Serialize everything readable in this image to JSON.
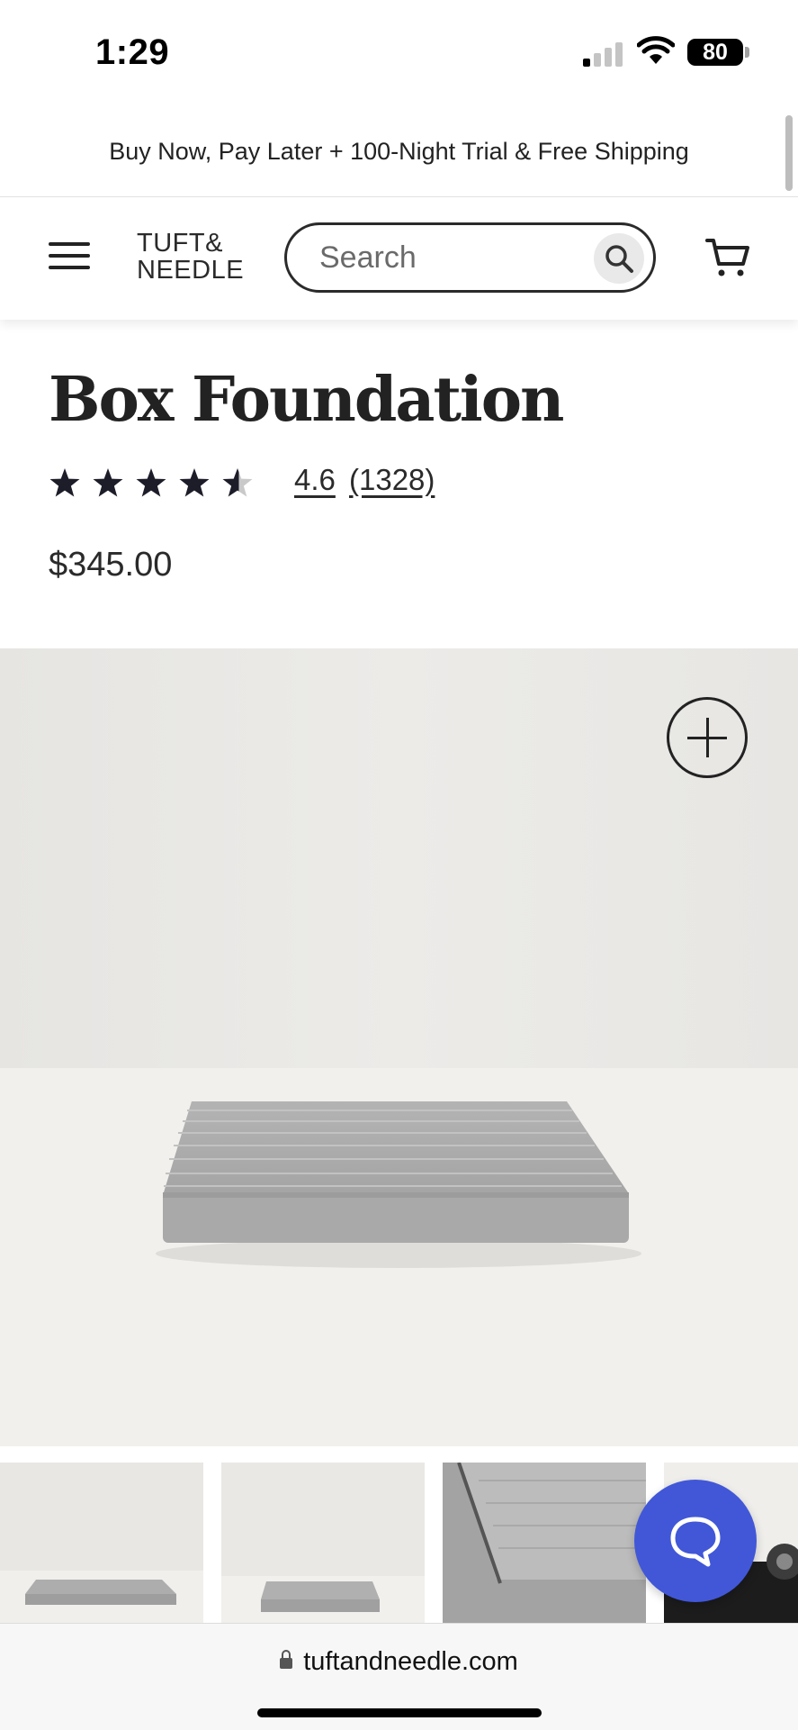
{
  "status_bar": {
    "time": "1:29",
    "battery": "80"
  },
  "promo": {
    "text": "Buy Now, Pay Later + 100-Night Trial & Free Shipping"
  },
  "header": {
    "logo_line1": "TUFT&",
    "logo_line2": "NEEDLE",
    "search_placeholder": "Search"
  },
  "product": {
    "title": "Box Foundation",
    "rating": 4.6,
    "rating_text": "4.6",
    "review_count": "(1328)",
    "price": "$345.00"
  },
  "gallery": {
    "thumbnail_count": 4
  },
  "browser": {
    "url": "tuftandneedle.com"
  },
  "colors": {
    "chat_button": "#4157d8",
    "text_dark": "#222222",
    "hero_bg": "#ebeae7"
  }
}
